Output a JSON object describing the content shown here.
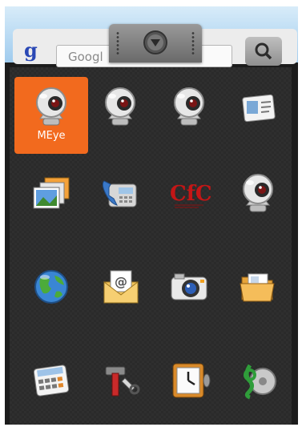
{
  "search": {
    "logo": "g",
    "placeholder": "Googl"
  },
  "drawer": {
    "handle_icon": "chevron-down-icon"
  },
  "apps": [
    {
      "label": "MEye",
      "icon": "webcam-icon",
      "selected": true
    },
    {
      "label": "",
      "icon": "webcam-icon"
    },
    {
      "label": "",
      "icon": "webcam-icon"
    },
    {
      "label": "",
      "icon": "contacts-card-icon"
    },
    {
      "label": "",
      "icon": "gallery-icon"
    },
    {
      "label": "",
      "icon": "phone-icon"
    },
    {
      "label": "",
      "icon": "cfc-logo-icon"
    },
    {
      "label": "",
      "icon": "webcam-icon"
    },
    {
      "label": "",
      "icon": "globe-icon"
    },
    {
      "label": "",
      "icon": "email-icon"
    },
    {
      "label": "",
      "icon": "camera-icon"
    },
    {
      "label": "",
      "icon": "folder-icon"
    },
    {
      "label": "",
      "icon": "calculator-icon"
    },
    {
      "label": "",
      "icon": "tools-icon"
    },
    {
      "label": "",
      "icon": "clock-icon"
    },
    {
      "label": "",
      "icon": "music-icon"
    }
  ],
  "colors": {
    "selected": "#f26a1e",
    "drawer_bg": "#2a2a2a"
  }
}
